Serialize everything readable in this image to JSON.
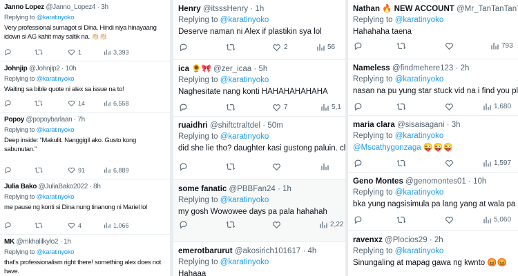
{
  "columns": [
    {
      "tweets": [
        {
          "name": "Janno Lopez",
          "handle": "@Janno_Lopez4",
          "sep": "·",
          "time": "3h",
          "replying_to": "Replying to",
          "mention": "@karatinyoko",
          "text": "Very professional sumagot si Dina. Hindi niya hinayaang idown si AG kahit may saltik na. 👏🏻👏🏻",
          "stats": {
            "retweets": "",
            "likes": "1",
            "views": "3,393"
          }
        },
        {
          "name": "Johnjip",
          "handle": "@Johnjip2",
          "sep": "·",
          "time": "10h",
          "replying_to": "Replying to",
          "mention": "@karatinyoko",
          "text": "Waiting sa bible quote ni alex sa issue na to!",
          "stats": {
            "retweets": "",
            "likes": "14",
            "views": "6,558"
          }
        },
        {
          "name": "Popoy",
          "handle": "@popoybarlaan",
          "sep": "·",
          "time": "7h",
          "replying_to": "Replying to",
          "mention": "@karatinyoko",
          "text": "Deep inside: “Makulit. Nanggigil ako. Gusto kong sabunutan.”",
          "stats": {
            "retweets": "",
            "likes": "91",
            "views": "6,889"
          }
        },
        {
          "name": "Julia Bako",
          "handle": "@JuliaBako2022",
          "sep": "·",
          "time": "8h",
          "replying_to": "Replying to",
          "mention": "@karatinyoko",
          "text": "me pause ng konti si Dina nung tinanong ni Mariel lol",
          "stats": {
            "retweets": "",
            "likes": "4",
            "views": "1,066"
          }
        },
        {
          "name": "MK",
          "handle": "@mkhalilkylo2",
          "sep": "·",
          "time": "1h",
          "replying_to": "Replying to",
          "mention": "@karatinyoko",
          "text": "that's professionalism right there! something alex does not have.",
          "stats": {}
        }
      ]
    },
    {
      "tweets": [
        {
          "name": "Henry",
          "handle": "@itsssHenry",
          "sep": "·",
          "time": "1h",
          "replying_to": "Replying to",
          "mention": "@karatinyoko",
          "text": "Deserve naman ni Alex if plastikin sya lol",
          "stats": {
            "retweets": "",
            "likes": "2",
            "views": "56"
          }
        },
        {
          "name": "ica 🌻🎀",
          "handle": "@zer_icaa",
          "sep": "·",
          "time": "5h",
          "replying_to": "Replying to",
          "mention": "@karatinyoko",
          "text": "Naghesitate nang konti HAHAHAHAHAHA",
          "stats": {
            "retweets": "",
            "likes": "7",
            "views": "5,1"
          }
        },
        {
          "name": "ruaidhri",
          "handle": "@shiftctraltdel",
          "sep": "·",
          "time": "50m",
          "replying_to": "Replying to",
          "mention": "@karatinyoko",
          "text": "did she lie tho? daughter kasi gustong paluin. cha",
          "stats": {}
        },
        {
          "name": "some fanatic",
          "handle": "@PBBFan24",
          "sep": "·",
          "time": "1h",
          "replying_to": "Replying to",
          "mention": "@karatinyoko",
          "text": "my gosh Wowowee days pa pala hahahah",
          "stats": {
            "retweets": "",
            "likes": "",
            "views": "2,22"
          }
        },
        {
          "name": "emerotbarurut",
          "handle": "@akosirich101617",
          "sep": "·",
          "time": "4h",
          "replying_to": "Replying to",
          "mention": "@karatinyoko",
          "text": "Hahaaa",
          "stats": {}
        }
      ]
    },
    {
      "tweets": [
        {
          "name": "Nathan 🔥 NEW ACCOUNT",
          "handle": "@Mr_TanTanTanT",
          "sep": "·",
          "time": "",
          "replying_to": "Replying to",
          "mention": "@karatinyoko",
          "text": "Hahahaha taena",
          "stats": {
            "retweets": "",
            "likes": "",
            "views": "793"
          }
        },
        {
          "name": "Nameless",
          "handle": "@findmehere123",
          "sep": "·",
          "time": "2h",
          "replying_to": "Replying to",
          "mention": "@karatinyoko",
          "text": "nasan na pu yung star stuck vid na i find you plastic",
          "stats": {
            "retweets": "",
            "likes": "",
            "views": "1,680"
          }
        },
        {
          "name": "maria clara",
          "handle": "@sisaisagani",
          "sep": "·",
          "time": "3h",
          "replying_to": "Replying to",
          "mention": "@karatinyoko",
          "text": "@Mscathygonzaga 😜😜😜",
          "stats": {
            "retweets": "",
            "likes": "",
            "views": "1,597"
          }
        },
        {
          "name": "Geno Montes",
          "handle": "@genomontes01",
          "sep": "·",
          "time": "10h",
          "replying_to": "Replying to",
          "mention": "@karatinyoko",
          "text": "bka yung nagsisimula pa lang yang at wala pa late l",
          "stats": {
            "retweets": "",
            "likes": "",
            "views": "5,060"
          }
        },
        {
          "name": "ravenxz",
          "handle": "@Plocios29",
          "sep": "·",
          "time": "2h",
          "replying_to": "Replying to",
          "mention": "@karatinyoko",
          "text": "Sinungaling at mapag gawa ng kwnto 😡😡",
          "stats": {}
        }
      ]
    }
  ],
  "colors": {
    "accent": "#1d9bf0",
    "text": "#0f1419",
    "muted": "#536471",
    "verified": "#1d9bf0",
    "divider": "#e9ecef"
  },
  "icons": [
    "reply-icon",
    "retweet-icon",
    "like-icon",
    "views-icon",
    "verified-badge-icon"
  ]
}
